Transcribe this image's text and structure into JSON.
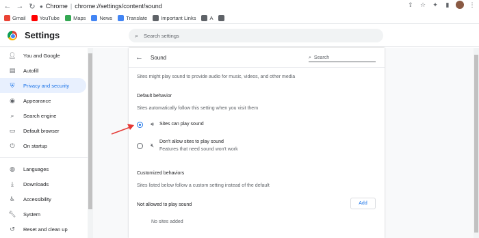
{
  "browser": {
    "url_label": "Chrome",
    "url_path": "chrome://settings/content/sound"
  },
  "bookmarks": [
    {
      "label": "Gmail",
      "icon": "gmail-icon",
      "color": "#ea4335"
    },
    {
      "label": "YouTube",
      "icon": "youtube-icon",
      "color": "#ff0000"
    },
    {
      "label": "Maps",
      "icon": "maps-icon",
      "color": "#34a853"
    },
    {
      "label": "News",
      "icon": "news-icon",
      "color": "#4285f4"
    },
    {
      "label": "Translate",
      "icon": "translate-icon",
      "color": "#4285f4"
    },
    {
      "label": "Important Links",
      "icon": "globe-icon",
      "color": "#5f6368"
    },
    {
      "label": "A",
      "icon": "globe-icon",
      "color": "#5f6368"
    },
    {
      "label": "",
      "icon": "globe-icon",
      "color": "#5f6368"
    }
  ],
  "header": {
    "title": "Settings",
    "search_placeholder": "Search settings"
  },
  "sidebar": {
    "items": [
      {
        "label": "You and Google",
        "icon": "person-icon"
      },
      {
        "label": "Autofill",
        "icon": "clipboard-icon"
      },
      {
        "label": "Privacy and security",
        "icon": "shield-icon",
        "active": true
      },
      {
        "label": "Appearance",
        "icon": "palette-icon"
      },
      {
        "label": "Search engine",
        "icon": "search-icon"
      },
      {
        "label": "Default browser",
        "icon": "browser-icon"
      },
      {
        "label": "On startup",
        "icon": "power-icon"
      }
    ],
    "items2": [
      {
        "label": "Languages",
        "icon": "globe-icon"
      },
      {
        "label": "Downloads",
        "icon": "download-icon"
      },
      {
        "label": "Accessibility",
        "icon": "accessibility-icon"
      },
      {
        "label": "System",
        "icon": "wrench-icon"
      },
      {
        "label": "Reset and clean up",
        "icon": "reset-icon"
      }
    ]
  },
  "sound": {
    "title": "Sound",
    "search_placeholder": "Search",
    "description": "Sites might play sound to provide audio for music, videos, and other media",
    "default_heading": "Default behavior",
    "default_sub": "Sites automatically follow this setting when you visit them",
    "option_allow": "Sites can play sound",
    "option_block": "Don't allow sites to play sound",
    "option_block_sub": "Features that need sound won't work",
    "custom_heading": "Customized behaviors",
    "custom_sub": "Sites listed below follow a custom setting instead of the default",
    "not_allowed_label": "Not allowed to play sound",
    "add_button": "Add",
    "empty_text": "No sites added"
  },
  "colors": {
    "accent": "#1a73e8",
    "annotation_arrow": "#e53935"
  }
}
